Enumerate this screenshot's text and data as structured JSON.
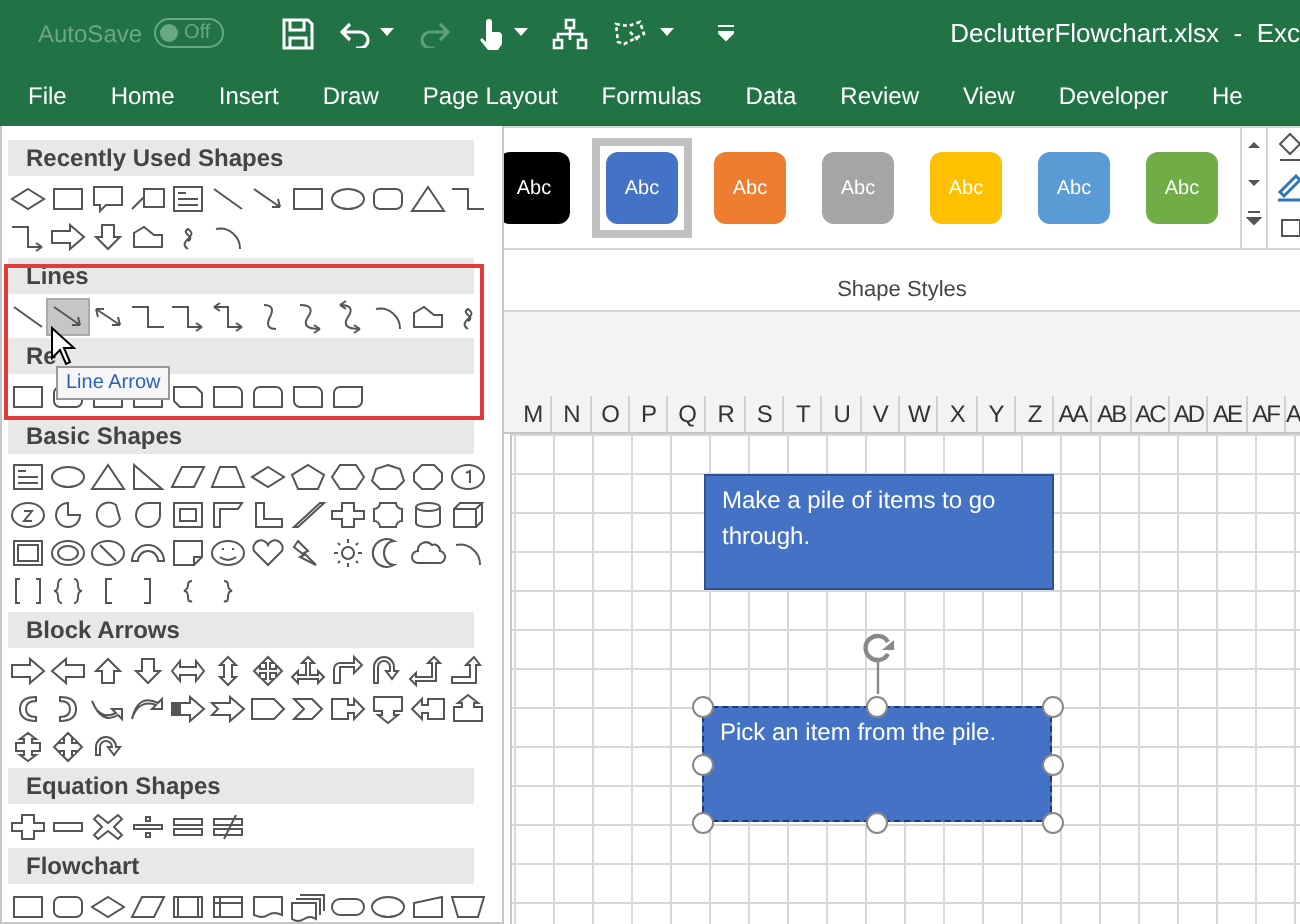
{
  "title_bar": {
    "autosave_label": "AutoSave",
    "autosave_toggle": {
      "label": "Off",
      "on": false
    },
    "file_title": "DeclutterFlowchart.xlsx  -  Exc"
  },
  "ribbon_tabs": [
    {
      "label": "File",
      "selected": false
    },
    {
      "label": "Home",
      "selected": false
    },
    {
      "label": "Insert",
      "selected": false
    },
    {
      "label": "Draw",
      "selected": false
    },
    {
      "label": "Page Layout",
      "selected": false
    },
    {
      "label": "Formulas",
      "selected": false
    },
    {
      "label": "Data",
      "selected": false
    },
    {
      "label": "Review",
      "selected": false
    },
    {
      "label": "View",
      "selected": false
    },
    {
      "label": "Developer",
      "selected": false
    },
    {
      "label": "He",
      "selected": false
    }
  ],
  "shapes_panel": {
    "sections": [
      {
        "title": "Recently Used Shapes"
      },
      {
        "title": "Lines",
        "highlighted": true,
        "shapes": [
          {
            "kind": "line",
            "hovered": false
          },
          {
            "kind": "line-arrow",
            "hovered": true
          },
          {
            "kind": "line-double",
            "hovered": false
          },
          {
            "kind": "elbow",
            "hovered": false
          },
          {
            "kind": "elbow-arrow",
            "hovered": false
          },
          {
            "kind": "elbow-double",
            "hovered": false
          },
          {
            "kind": "curve",
            "hovered": false
          },
          {
            "kind": "curve-arrow",
            "hovered": false
          },
          {
            "kind": "curve-double",
            "hovered": false
          },
          {
            "kind": "arc",
            "hovered": false
          },
          {
            "kind": "freeform",
            "hovered": false
          },
          {
            "kind": "scribble",
            "hovered": false
          }
        ]
      },
      {
        "title": "Re"
      },
      {
        "title": "Basic Shapes"
      },
      {
        "title": "Block Arrows"
      },
      {
        "title": "Equation Shapes"
      },
      {
        "title": "Flowchart"
      }
    ]
  },
  "tooltip": {
    "text": "Line Arrow"
  },
  "shape_styles": {
    "label": "Shape Styles",
    "swatches": [
      {
        "label": "Abc",
        "color": "#000000",
        "selected": false
      },
      {
        "label": "Abc",
        "color": "#4472c4",
        "selected": true
      },
      {
        "label": "Abc",
        "color": "#ed7d31",
        "selected": false
      },
      {
        "label": "Abc",
        "color": "#a5a5a5",
        "selected": false
      },
      {
        "label": "Abc",
        "color": "#ffc000",
        "selected": false
      },
      {
        "label": "Abc",
        "color": "#5b9bd5",
        "selected": false
      },
      {
        "label": "Abc",
        "color": "#70ad47",
        "selected": false
      }
    ]
  },
  "sheet": {
    "columns": [
      "M",
      "N",
      "O",
      "P",
      "Q",
      "R",
      "S",
      "T",
      "U",
      "V",
      "W",
      "X",
      "Y",
      "Z",
      "AA",
      "AB",
      "AC",
      "AD",
      "AE",
      "AF",
      "A"
    ],
    "shapes": [
      {
        "text": "Make a pile of items to go through.",
        "selected": false
      },
      {
        "text": "Pick an item from the pile.",
        "selected": true
      }
    ]
  }
}
